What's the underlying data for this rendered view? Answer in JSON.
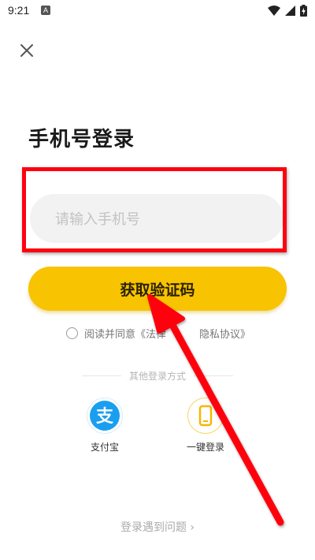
{
  "status_bar": {
    "time": "9:21",
    "notification_letter": "A",
    "icons": [
      "wifi-icon",
      "signal-icon",
      "battery-charging-icon"
    ]
  },
  "header": {
    "close_icon": "close-icon"
  },
  "title": "手机号登录",
  "phone_input": {
    "placeholder": "请输入手机号",
    "value": ""
  },
  "get_code_button": "获取验证码",
  "agreement": {
    "checked": false,
    "text": "阅读并同意《法律",
    "privacy_link": "隐私协议》"
  },
  "other_methods": {
    "label": "其他登录方式",
    "options": [
      {
        "label": "支付宝",
        "icon": "alipay-icon",
        "color": "#1a9ff0",
        "glyph": "支"
      },
      {
        "label": "一键登录",
        "icon": "phone-icon",
        "color": "#f8c301"
      }
    ]
  },
  "trouble_link": "登录遇到问题 ›",
  "annotation": {
    "frame_color": "#ff0010",
    "arrow_color": "#ff0010"
  }
}
